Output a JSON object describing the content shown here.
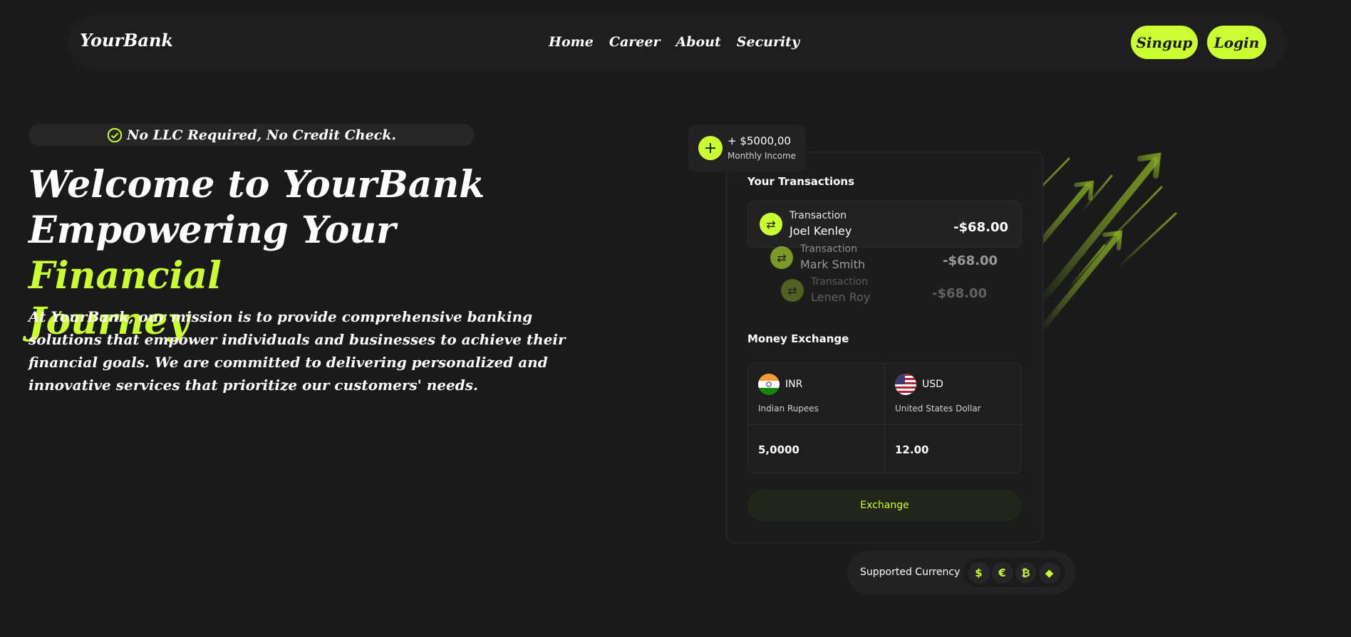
{
  "nav": {
    "logo": "YourBank",
    "links": [
      "Home",
      "Career",
      "About",
      "Security"
    ],
    "signup": "Singup",
    "login": "Login"
  },
  "hero": {
    "badge": "No LLC Required, No Credit Check.",
    "title_line1": "Welcome to YourBank",
    "title_line2": "Empowering Your ",
    "title_accent1": "Financial",
    "title_accent2": "Journey",
    "description": "At YourBank, our mission is to provide comprehensive banking solutions that empower individuals and businesses to achieve their financial goals. We are committed to delivering personalized and innovative services that prioritize our customers' needs."
  },
  "income": {
    "amount": "+ $5000,00",
    "label": "Monthly Income"
  },
  "transactions": {
    "title": "Your Transactions",
    "items": [
      {
        "type": "Transaction",
        "name": "Joel Kenley",
        "amount": "-$68.00"
      },
      {
        "type": "Transaction",
        "name": "Mark Smith",
        "amount": "-$68.00"
      },
      {
        "type": "Transaction",
        "name": "Lenen Roy",
        "amount": "-$68.00"
      }
    ]
  },
  "exchange": {
    "title": "Money Exchange",
    "from": {
      "code": "INR",
      "name": "Indian Rupees",
      "value": "5,0000"
    },
    "to": {
      "code": "USD",
      "name": "United States Dollar",
      "value": "12.00"
    },
    "button": "Exchange"
  },
  "supported": {
    "label": "Supported Currency",
    "coins": [
      "$",
      "€",
      "₿",
      "◆"
    ]
  },
  "colors": {
    "accent": "#caff33",
    "background": "#1a1a1a"
  }
}
